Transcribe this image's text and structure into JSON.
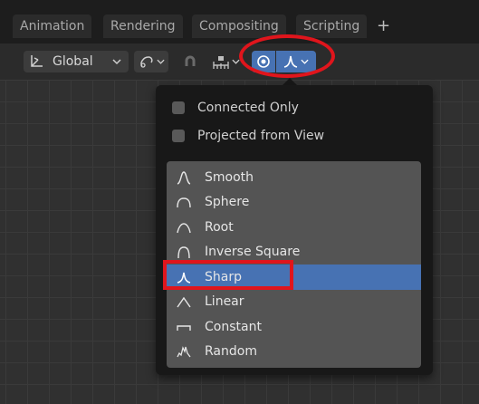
{
  "tabs": [
    "Animation",
    "Rendering",
    "Compositing",
    "Scripting",
    "+"
  ],
  "toolbar": {
    "orientation_label": "Global",
    "orientation_icon": "transform-orientation-icon",
    "pivot_icon": "pivot-point-icon",
    "snap_icon": "magnet-icon",
    "snap_increment_icon": "snap-increment-icon",
    "proportional_editing_icon": "proportional-editing-icon",
    "falloff_icon": "sharp-falloff-icon",
    "active_color": "#4772b3"
  },
  "dropdown": {
    "checkboxes": [
      {
        "label": "Connected Only",
        "checked": false
      },
      {
        "label": "Projected from View",
        "checked": false
      }
    ],
    "falloff_options": [
      {
        "label": "Smooth",
        "icon": "smooth-curve-icon"
      },
      {
        "label": "Sphere",
        "icon": "sphere-curve-icon"
      },
      {
        "label": "Root",
        "icon": "root-curve-icon"
      },
      {
        "label": "Inverse Square",
        "icon": "inverse-square-curve-icon"
      },
      {
        "label": "Sharp",
        "icon": "sharp-curve-icon",
        "selected": true
      },
      {
        "label": "Linear",
        "icon": "linear-curve-icon"
      },
      {
        "label": "Constant",
        "icon": "constant-curve-icon"
      },
      {
        "label": "Random",
        "icon": "random-curve-icon"
      }
    ]
  },
  "annotation_color": "#e0151c"
}
